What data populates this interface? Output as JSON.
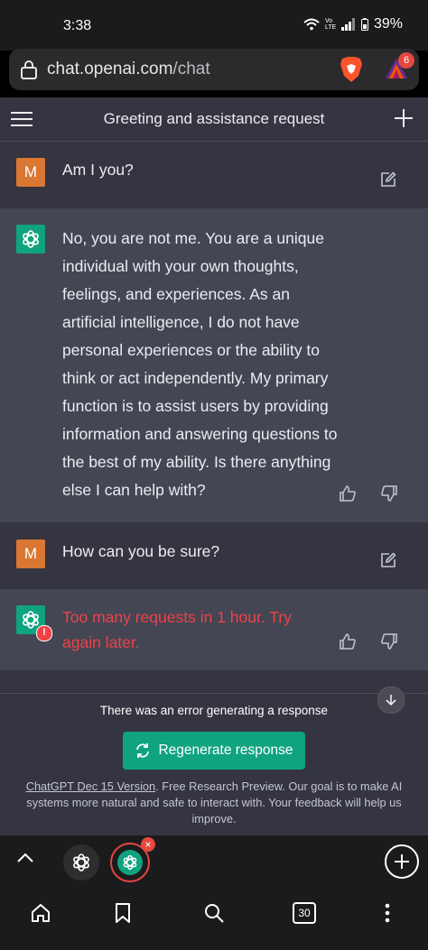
{
  "status_bar": {
    "time": "3:38",
    "signal_label": "Vo LTE",
    "battery": "39%"
  },
  "browser": {
    "url_host": "chat.openai.com",
    "url_path": "/chat",
    "rewards_badge": "6"
  },
  "chat_header": {
    "title": "Greeting and assistance request"
  },
  "messages": [
    {
      "role": "user",
      "avatar": "M",
      "text": "Am I you?"
    },
    {
      "role": "assistant",
      "text": "No, you are not me. You are a unique individual with your own thoughts, feelings, and experiences. As an artificial intelligence, I do not have personal experiences or the ability to think or act independently. My primary function is to assist users by providing information and answering questions to the best of my ability. Is there anything else I can help with?"
    },
    {
      "role": "user",
      "avatar": "M",
      "text": "How can you be sure?"
    },
    {
      "role": "assistant",
      "text": "Too many requests in 1 hour. Try again later.",
      "error": true,
      "error_badge": "!"
    }
  ],
  "bottom": {
    "error_text": "There was an error generating a response",
    "regenerate_label": "Regenerate response",
    "footnote_link": "ChatGPT Dec 15 Version",
    "footnote_text": ". Free Research Preview. Our goal is to make AI systems more natural and safe to interact with. Your feedback will help us improve."
  },
  "tab_strip": {
    "close_glyph": "×"
  },
  "bottom_nav": {
    "tab_count": "30"
  },
  "colors": {
    "accent_green": "#10a37f",
    "user_avatar": "#d97733",
    "error_red": "#ef4146",
    "brave_orange": "#fb542b"
  }
}
